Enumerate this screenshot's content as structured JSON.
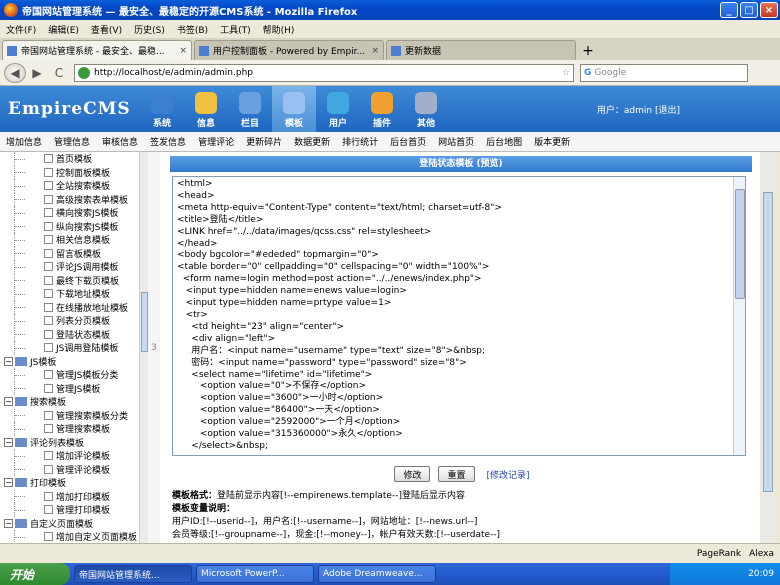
{
  "window": {
    "title": "帝国网站管理系统 — 最安全、最稳定的开源CMS系统 - Mozilla Firefox",
    "minimize": "_",
    "maximize": "□",
    "close": "×"
  },
  "menubar": [
    "文件(F)",
    "编辑(E)",
    "查看(V)",
    "历史(S)",
    "书签(B)",
    "工具(T)",
    "帮助(H)"
  ],
  "tabs": [
    {
      "label": "帝国网站管理系统 - 最安全、最稳...",
      "active": true
    },
    {
      "label": "用户控制面板 - Powered by Empir...",
      "active": false
    },
    {
      "label": "更新数据",
      "active": false
    }
  ],
  "new_tab": "+",
  "nav": {
    "url": "http://localhost/e/admin/admin.php",
    "search_placeholder": "Google",
    "back": "◀",
    "forward": "▶",
    "reload": "C",
    "star": "☆"
  },
  "cms": {
    "logo": "EmpireCMS",
    "top_nav": [
      {
        "label": "系统",
        "icon": "globe-icon",
        "color": "#3a7fd0"
      },
      {
        "label": "信息",
        "icon": "notepad-icon",
        "color": "#f0c040"
      },
      {
        "label": "栏目",
        "icon": "columns-icon",
        "color": "#6aa0e0"
      },
      {
        "label": "模板",
        "icon": "template-icon",
        "color": "#9ac0f0",
        "active": true
      },
      {
        "label": "用户",
        "icon": "user-icon",
        "color": "#40a8e0"
      },
      {
        "label": "插件",
        "icon": "tools-icon",
        "color": "#f0a030"
      },
      {
        "label": "其他",
        "icon": "gear-icon",
        "color": "#a0b0c8"
      }
    ],
    "user_label": "用户：admin [退出]"
  },
  "submenu": [
    "增加信息",
    "管理信息",
    "审核信息",
    "签发信息",
    "管理评论",
    "更新碎片",
    "数据更新",
    "排行统计",
    "后台首页",
    "网站首页",
    "后台地图",
    "版本更新"
  ],
  "tree": [
    {
      "label": "首页模板",
      "type": "child"
    },
    {
      "label": "控制面板模板",
      "type": "child"
    },
    {
      "label": "全站搜索模板",
      "type": "child"
    },
    {
      "label": "高级搜索表单模板",
      "type": "child"
    },
    {
      "label": "横向搜索JS模板",
      "type": "child"
    },
    {
      "label": "纵向搜索JS模板",
      "type": "child"
    },
    {
      "label": "相关信息模板",
      "type": "child"
    },
    {
      "label": "留言板模板",
      "type": "child"
    },
    {
      "label": "评论JS调用模板",
      "type": "child"
    },
    {
      "label": "最终下载页模板",
      "type": "child"
    },
    {
      "label": "下载地址模板",
      "type": "child"
    },
    {
      "label": "在线播放地址模板",
      "type": "child"
    },
    {
      "label": "列表分页模板",
      "type": "child"
    },
    {
      "label": "登陆状态模板",
      "type": "child"
    },
    {
      "label": "JS调用登陆模板",
      "type": "child"
    },
    {
      "label": "JS模板",
      "type": "group"
    },
    {
      "label": "管理JS模板分类",
      "type": "child"
    },
    {
      "label": "管理JS模板",
      "type": "child"
    },
    {
      "label": "搜索模板",
      "type": "group"
    },
    {
      "label": "管理搜索模板分类",
      "type": "child"
    },
    {
      "label": "管理搜索模板",
      "type": "child"
    },
    {
      "label": "评论列表模板",
      "type": "group"
    },
    {
      "label": "增加评论模板",
      "type": "child"
    },
    {
      "label": "管理评论模板",
      "type": "child"
    },
    {
      "label": "打印模板",
      "type": "group"
    },
    {
      "label": "增加打印模板",
      "type": "child"
    },
    {
      "label": "管理打印模板",
      "type": "child"
    },
    {
      "label": "自定义页面模板",
      "type": "group"
    },
    {
      "label": "增加自定义页面模板",
      "type": "child"
    }
  ],
  "splitter": "3",
  "main": {
    "panel_title": "登陆状态模板 (预览)",
    "code_lines": [
      "<html>",
      "<head>",
      "<meta http-equiv=\"Content-Type\" content=\"text/html; charset=utf-8\">",
      "<title>登陆</title>",
      "<LINK href=\"../../data/images/qcss.css\" rel=stylesheet>",
      "</head>",
      "<body bgcolor=\"#ededed\" topmargin=\"0\">",
      "<table border=\"0\" cellpadding=\"0\" cellspacing=\"0\" width=\"100%\">",
      "  <form name=login method=post action=\"../../enews/index.php\">",
      "   <input type=hidden name=enews value=login>",
      "   <input type=hidden name=prtype value=1>",
      "   <tr>",
      "     <td height=\"23\" align=\"center\">",
      "     <div align=\"left\">",
      "     用户名：<input name=\"username\" type=\"text\" size=\"8\">&nbsp;",
      "     密码：<input name=\"password\" type=\"password\" size=\"8\">",
      "     <select name=\"lifetime\" id=\"lifetime\">",
      "        <option value=\"0\">不保存</option>",
      "        <option value=\"3600\">一小时</option>",
      "        <option value=\"86400\">一天</option>",
      "        <option value=\"2592000\">一个月</option>",
      "        <option value=\"315360000\">永久</option>",
      "     </select>&nbsp;"
    ],
    "btn_modify": "修改",
    "btn_reset": "重置",
    "link_history": "[修改记录]",
    "help": {
      "format_label": "模板格式：",
      "format_text": "登陆前显示内容[!--empirenews.template--]登陆后显示内容",
      "vars_label": "模板变量说明：",
      "vars_line1": "用户ID:[!--userid--]，用户名:[!--username--]，网站地址：[!--news.url--]",
      "vars_line2": "会员等级:[!--groupname--]，现金:[!--money--]，帐户有效天数:[!--userdate--]"
    }
  },
  "status": {
    "pagerank": "PageRank",
    "alexa": "Alexa"
  },
  "taskbar": {
    "start": "开始",
    "tasks": [
      {
        "label": "帝国网站管理系统...",
        "active": true
      },
      {
        "label": "Microsoft PowerP...",
        "active": false
      },
      {
        "label": "Adobe Dreamweave...",
        "active": false
      }
    ],
    "clock": "20:09"
  }
}
